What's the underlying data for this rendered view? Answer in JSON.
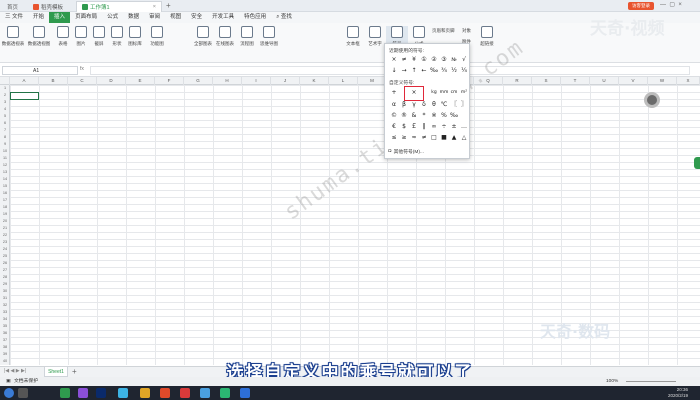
{
  "tabs": [
    {
      "label": "首页"
    },
    {
      "label": "稻壳模板"
    },
    {
      "label": "工作簿1"
    }
  ],
  "new_tab_symbol": "+",
  "top_right": {
    "login_label": "访客登录"
  },
  "menu": {
    "file": "三 文件",
    "items": [
      "开始",
      "插入",
      "页面布局",
      "公式",
      "数据",
      "审阅",
      "视图",
      "安全",
      "开发工具",
      "特色应用"
    ],
    "active": "插入",
    "search": "查找"
  },
  "ribbon": {
    "buttons": [
      "数据透视表",
      "数据透视图",
      "表格",
      "图片",
      "截屏",
      "形状",
      "图标库",
      "功能图",
      "全部图表",
      "在线图表",
      "流程图",
      "思维导图",
      "文本框",
      "艺术字",
      "符号",
      "公式",
      "超链接"
    ],
    "extra_labels": [
      "页眉和页脚",
      "对象",
      "附件",
      "照相机"
    ]
  },
  "formula_bar": {
    "name_box": "A1",
    "fx": "fx"
  },
  "columns": [
    "A",
    "B",
    "C",
    "D",
    "E",
    "F",
    "G",
    "H",
    "I",
    "J",
    "K",
    "L",
    "M",
    "N",
    "O",
    "P",
    "Q",
    "R",
    "S",
    "T",
    "U",
    "V",
    "W",
    "X"
  ],
  "rows": [
    "1",
    "2",
    "3",
    "4",
    "5",
    "6",
    "7",
    "8",
    "9",
    "10",
    "11",
    "12",
    "13",
    "14",
    "15",
    "16",
    "17",
    "18",
    "19",
    "20",
    "21",
    "22",
    "23",
    "24",
    "25",
    "26",
    "27",
    "28",
    "29",
    "30",
    "31",
    "32",
    "33",
    "34",
    "35",
    "36",
    "37",
    "38",
    "39",
    "40"
  ],
  "symbol_popup": {
    "recent_title": "近期使用的符号:",
    "recent": [
      [
        "×",
        "≠",
        "¥",
        "①",
        "②",
        "③",
        "№",
        "√"
      ],
      [
        "↓",
        "→",
        "↑",
        "←",
        "‰",
        "¾",
        "½",
        "¼"
      ]
    ],
    "custom_title": "自定义符号:",
    "custom": [
      [
        "+",
        "×",
        "",
        "kg",
        "mm",
        "cm",
        "m²"
      ],
      [
        "α",
        "β",
        "γ",
        "δ",
        "θ",
        "℃",
        "〖",
        "〗"
      ],
      [
        "©",
        "®",
        "&",
        "*",
        "※",
        "%",
        "‰",
        ""
      ],
      [
        "€",
        "$",
        "￡",
        "‖",
        "∞",
        "÷",
        "±",
        "…"
      ],
      [
        "≤",
        "≥",
        "≈",
        "≠",
        "□",
        "■",
        "▲",
        "△"
      ]
    ],
    "more": "其他符号(M)..."
  },
  "sheet": {
    "tab": "Sheet1",
    "add": "+"
  },
  "status": {
    "left": "文档未保护",
    "zoom": "100%"
  },
  "taskbar": {
    "time": "20:36",
    "date": "2020/2/19"
  },
  "subtitle": "选择自定义中的乘号就可以了",
  "watermark": "shuma.tianqijun.com",
  "logos": {
    "top": "天奇·视频",
    "bottom": "天奇·数码"
  },
  "colors": {
    "accent": "#2f9a4e",
    "highlight": "#e0283a",
    "subtitle_outline": "#1b3f8f"
  }
}
